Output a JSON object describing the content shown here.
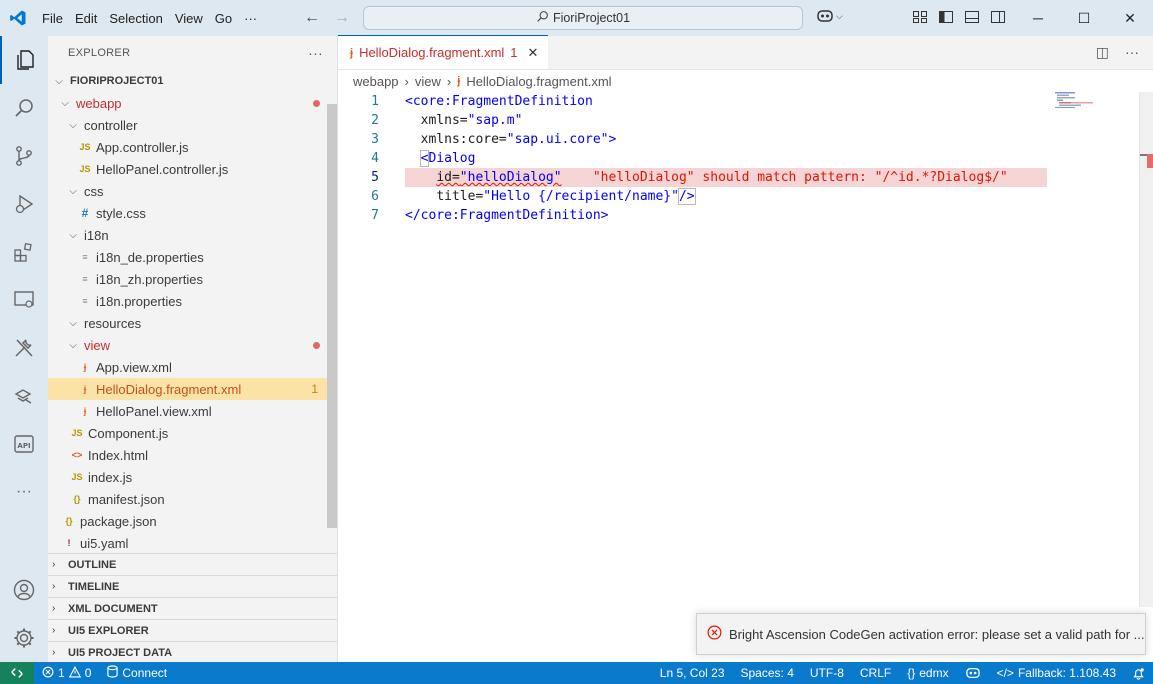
{
  "menu": [
    "File",
    "Edit",
    "Selection",
    "View",
    "Go",
    "···"
  ],
  "command_center": "FioriProject01",
  "explorer": {
    "title": "EXPLORER",
    "project": "FIORIPROJECT01",
    "tree": [
      {
        "label": "webapp",
        "kind": "folder-open",
        "depth": 1,
        "modified": true
      },
      {
        "label": "controller",
        "kind": "folder-open",
        "depth": 2
      },
      {
        "label": "App.controller.js",
        "kind": "js",
        "depth": 3
      },
      {
        "label": "HelloPanel.controller.js",
        "kind": "js",
        "depth": 3
      },
      {
        "label": "css",
        "kind": "folder-open",
        "depth": 2
      },
      {
        "label": "style.css",
        "kind": "css",
        "depth": 3
      },
      {
        "label": "i18n",
        "kind": "folder-open",
        "depth": 2
      },
      {
        "label": "i18n_de.properties",
        "kind": "props",
        "depth": 3
      },
      {
        "label": "i18n_zh.properties",
        "kind": "props",
        "depth": 3
      },
      {
        "label": "i18n.properties",
        "kind": "props",
        "depth": 3
      },
      {
        "label": "resources",
        "kind": "folder-open",
        "depth": 2
      },
      {
        "label": "view",
        "kind": "folder-open",
        "depth": 2,
        "modified": true
      },
      {
        "label": "App.view.xml",
        "kind": "xml",
        "depth": 3
      },
      {
        "label": "HelloDialog.fragment.xml",
        "kind": "xml",
        "depth": 3,
        "selected": true,
        "problems": "1"
      },
      {
        "label": "HelloPanel.view.xml",
        "kind": "xml",
        "depth": 3
      },
      {
        "label": "Component.js",
        "kind": "js",
        "depth": 2
      },
      {
        "label": "Index.html",
        "kind": "html",
        "depth": 2
      },
      {
        "label": "index.js",
        "kind": "js",
        "depth": 2
      },
      {
        "label": "manifest.json",
        "kind": "json",
        "depth": 2
      },
      {
        "label": "package.json",
        "kind": "json",
        "depth": 1
      },
      {
        "label": "ui5.yaml",
        "kind": "yaml",
        "depth": 1
      }
    ],
    "sections": [
      "OUTLINE",
      "TIMELINE",
      "XML DOCUMENT",
      "UI5 EXPLORER",
      "UI5 PROJECT DATA"
    ]
  },
  "editor": {
    "tab_label": "HelloDialog.fragment.xml",
    "tab_problems": "1",
    "breadcrumb": [
      "webapp",
      "view",
      "HelloDialog.fragment.xml"
    ],
    "line_numbers": [
      "1",
      "2",
      "3",
      "4",
      "5",
      "6",
      "7"
    ],
    "code": {
      "l1_tag": "<core:FragmentDefinition",
      "l2_attr": "xmlns=",
      "l2_val": "\"sap.m\"",
      "l3_attr": "xmlns:core=",
      "l3_val": "\"sap.ui.core\"",
      "l3_close": ">",
      "l4_lt": "<",
      "l4_tag": "Dialog",
      "l5_attr": "id=",
      "l5_val": "\"helloDialog\"",
      "l5_error": "\"helloDialog\" should match pattern: \"/^id.*?Dialog$/\"",
      "l6_attr": "title=",
      "l6_val": "\"Hello {/recipient/name}\"",
      "l6_close": "/>",
      "l7_tag": "</core:FragmentDefinition>"
    }
  },
  "notification": {
    "message": "Bright Ascension CodeGen activation error: please set a valid path for ..."
  },
  "statusbar": {
    "errors": "1",
    "warnings": "0",
    "connect": "Connect",
    "position": "Ln 5, Col 23",
    "spaces": "Spaces: 4",
    "encoding": "UTF-8",
    "eol": "CRLF",
    "language": "edmx",
    "fallback": "Fallback: 1.108.43"
  },
  "colors": {
    "accent": "#005fb8",
    "statusbar": "#0a7acc",
    "remote": "#16825d",
    "error": "#e51400",
    "selected_row": "#fbe3a8"
  }
}
